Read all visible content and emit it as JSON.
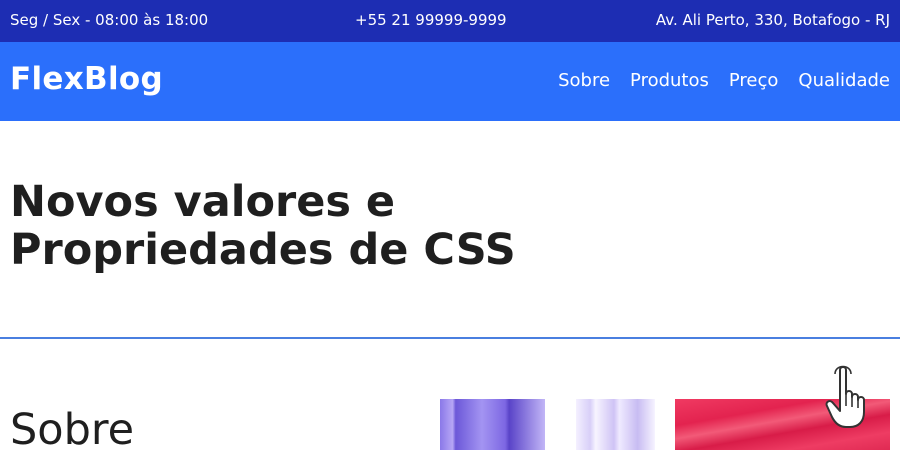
{
  "topbar": {
    "hours": "Seg / Sex - 08:00 às 18:00",
    "phone": "+55 21 99999-9999",
    "address": "Av. Ali Perto, 330, Botafogo - RJ"
  },
  "navbar": {
    "logo": "FlexBlog",
    "menu": [
      "Sobre",
      "Produtos",
      "Preço",
      "Qualidade"
    ]
  },
  "hero": {
    "title_line1": "Novos valores e",
    "title_line2": "Propriedades de CSS"
  },
  "section": {
    "title": "Sobre"
  },
  "colors": {
    "topbar_bg": "#1d2db3",
    "navbar_bg": "#2b6ffb",
    "divider": "#4a7fe0"
  },
  "icons": {
    "cursor": "hand-pointer-icon"
  }
}
